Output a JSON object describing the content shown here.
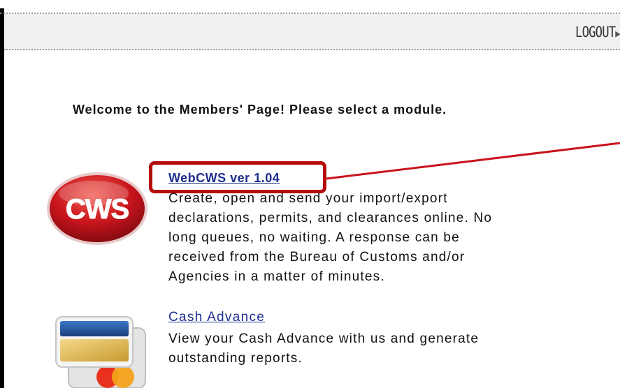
{
  "header": {
    "logout_label": "LOGOUT",
    "logout_arrow": "▶"
  },
  "main": {
    "welcome_text": "Welcome to the Members' Page! Please select a module.",
    "modules": [
      {
        "title": "WebCWS ver 1.04",
        "description_lines": [
          "Create, open and send your import/export",
          "declarations, permits, and clearances online. No",
          "long queues, no waiting. A response can be",
          "received from the Bureau of Customs and/or",
          "Agencies in a matter of minutes."
        ],
        "icon": "cws-logo-icon",
        "logo_text": "CWS"
      },
      {
        "title": "Cash Advance",
        "description_lines": [
          "View your Cash Advance with us and generate",
          "outstanding reports."
        ],
        "icon": "credit-card-icon"
      }
    ]
  },
  "colors": {
    "link": "#1d2e8f",
    "highlight": "#b50d0d",
    "logo_red": "#c8141c"
  }
}
